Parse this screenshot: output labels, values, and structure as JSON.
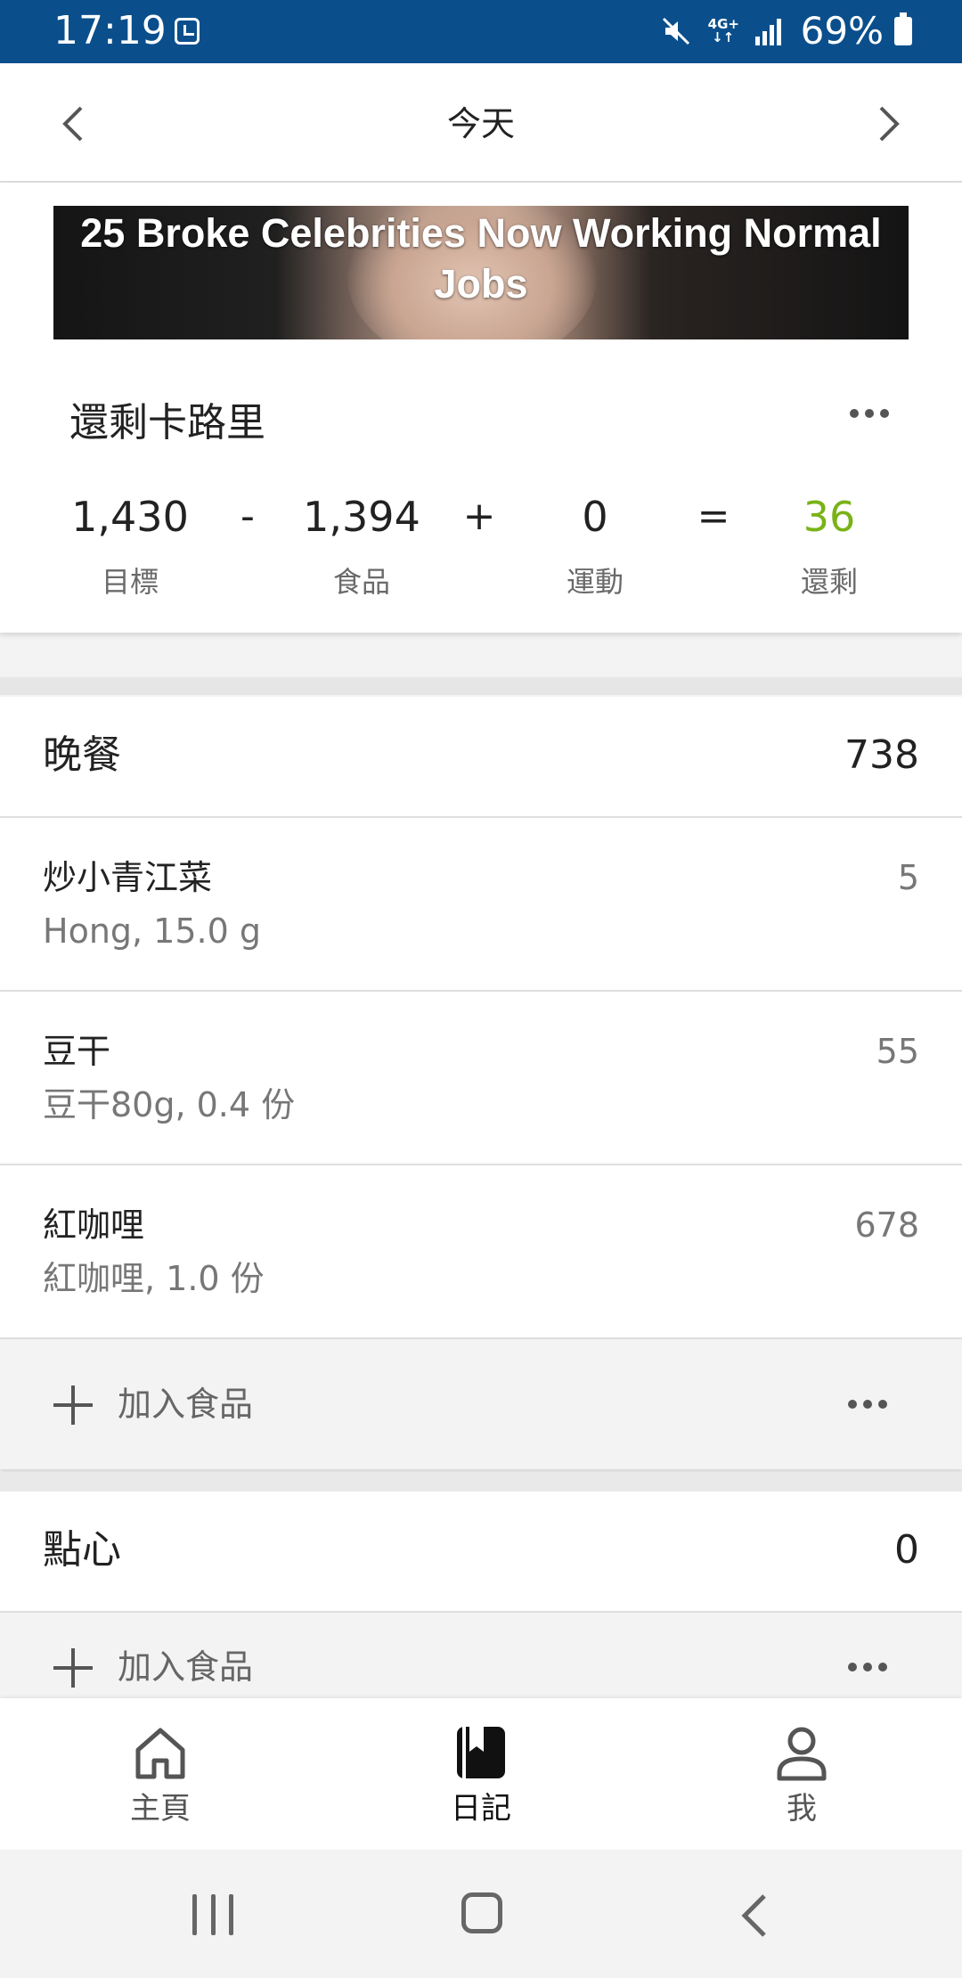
{
  "status_bar": {
    "time": "17:19",
    "network": "4G+",
    "battery": "69%",
    "icons": [
      "alarm-icon",
      "mute-icon",
      "network-4g-icon",
      "signal-icon",
      "battery-icon"
    ]
  },
  "date_nav": {
    "title": "今天",
    "prev_icon": "chevron-left-icon",
    "next_icon": "chevron-right-icon"
  },
  "ad": {
    "headline": "25 Broke Celebrities Now Working Normal Jobs"
  },
  "calories": {
    "title": "還剩卡路里",
    "goal": {
      "value": "1,430",
      "label": "目標"
    },
    "op1": "-",
    "food": {
      "value": "1,394",
      "label": "食品"
    },
    "op2": "+",
    "exercise": {
      "value": "0",
      "label": "運動"
    },
    "op3": "=",
    "remaining": {
      "value": "36",
      "label": "還剩",
      "color": "#7ab317"
    }
  },
  "meals": [
    {
      "name": "晚餐",
      "calories": "738",
      "items": [
        {
          "name": "炒小青江菜",
          "detail": "Hong, 15.0 g",
          "calories": "5"
        },
        {
          "name": "豆干",
          "detail": "豆干80g, 0.4 份",
          "calories": "55"
        },
        {
          "name": "紅咖哩",
          "detail": "紅咖哩, 1.0 份",
          "calories": "678"
        }
      ],
      "add_label": "加入食品"
    },
    {
      "name": "點心",
      "calories": "0",
      "items": [],
      "add_label": "加入食品"
    }
  ],
  "bottom_nav": [
    {
      "label": "主頁",
      "icon": "home-icon",
      "active": false
    },
    {
      "label": "日記",
      "icon": "diary-book-icon",
      "active": true
    },
    {
      "label": "我",
      "icon": "profile-icon",
      "active": false
    }
  ],
  "system_nav": {
    "icons": [
      "recent-apps-icon",
      "home-button-icon",
      "back-icon"
    ]
  }
}
